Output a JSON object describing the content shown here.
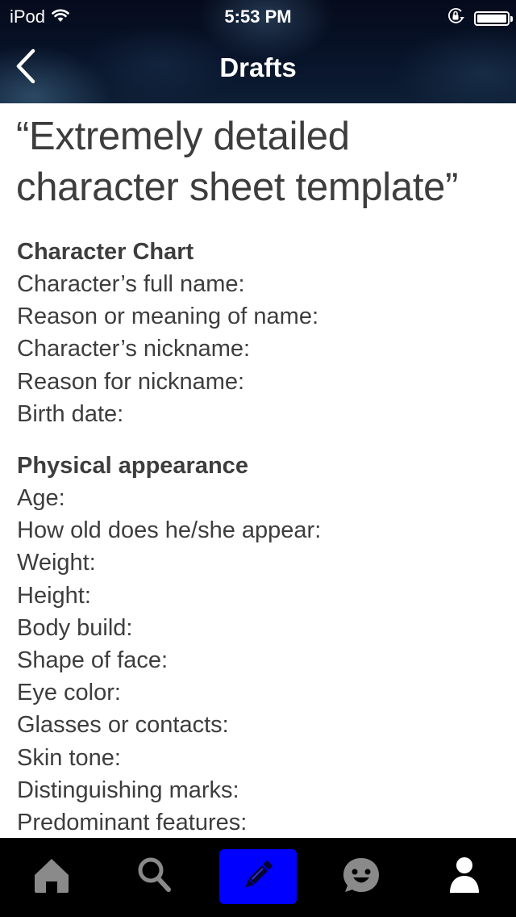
{
  "status_bar": {
    "carrier": "iPod",
    "time": "5:53 PM",
    "wifi_icon": "wifi-icon",
    "orientation_lock_icon": "orientation-lock-icon",
    "battery_icon": "battery-icon",
    "battery_level": 1.0
  },
  "nav": {
    "back_icon": "chevron-left-icon",
    "title": "Drafts"
  },
  "document": {
    "title": "“Extremely detailed character sheet template”",
    "sections": [
      {
        "heading": "Character Chart",
        "fields": [
          "Character’s full name:",
          "Reason or meaning of name:",
          "Character’s nickname:",
          "Reason for nickname:",
          "Birth date:"
        ]
      },
      {
        "heading": "Physical appearance",
        "fields": [
          "Age:",
          "How old does he/she appear:",
          "Weight:",
          "Height:",
          "Body build:",
          "Shape of face:",
          "Eye color:",
          "Glasses or contacts:",
          "Skin tone:",
          "Distinguishing marks:",
          "Predominant features:"
        ]
      }
    ]
  },
  "tab_bar": {
    "active_color": "#0000ff",
    "inactive_color": "#8a8a8a",
    "tabs": [
      {
        "name": "home",
        "icon": "home-icon",
        "active": false
      },
      {
        "name": "search",
        "icon": "search-icon",
        "active": false
      },
      {
        "name": "write",
        "icon": "pencil-icon",
        "active": true
      },
      {
        "name": "chat",
        "icon": "chat-smiley-icon",
        "active": false
      },
      {
        "name": "profile",
        "icon": "person-icon",
        "active": false
      }
    ]
  }
}
